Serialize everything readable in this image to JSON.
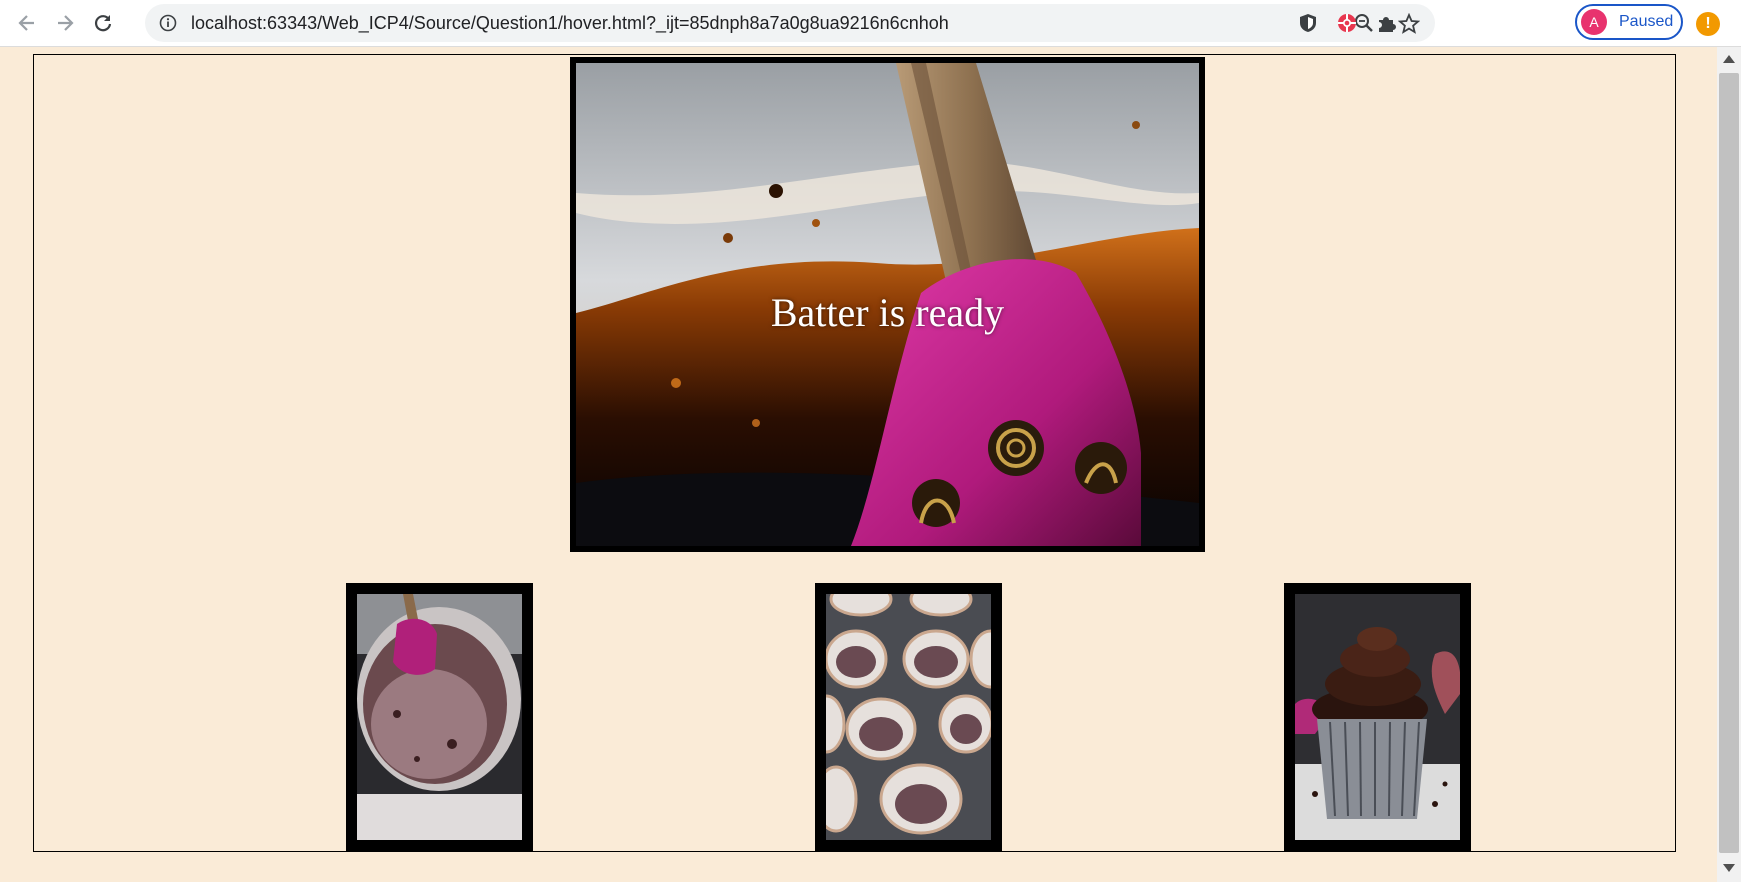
{
  "browser": {
    "url": "localhost:63343/Web_ICP4/Source/Question1/hover.html?_ijt=85dnph8a7a0g8ua9216n6cnhoh",
    "profile_initial": "A",
    "profile_status": "Paused",
    "alert_symbol": "!",
    "colors": {
      "accent": "#1a56c8",
      "avatar": "#e8336e",
      "alert": "#f29900"
    }
  },
  "page": {
    "background": "#faebd7",
    "hero": {
      "caption": "Batter is ready",
      "image": "spatula-in-chocolate-batter"
    },
    "thumbnails": [
      {
        "image": "batter-bowl-with-spatula"
      },
      {
        "image": "cupcake-liners-in-tin"
      },
      {
        "image": "frosted-chocolate-cupcake"
      }
    ]
  }
}
